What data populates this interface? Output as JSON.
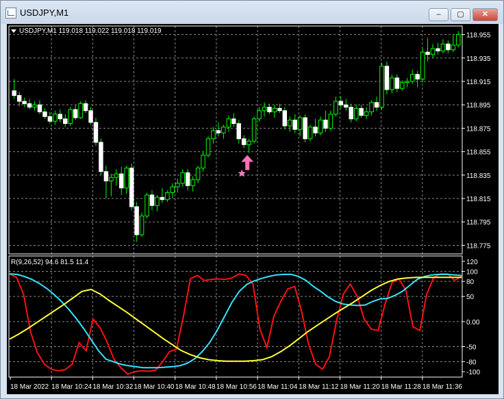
{
  "window": {
    "title": "USDJPY,M1",
    "minimize_glyph": "–",
    "maximize_glyph": "▢",
    "close_glyph": "✕"
  },
  "main_panel": {
    "info": "USDJPY,M1  119.018 119.022 119.018 119.019",
    "price_ticks": [
      "118.955",
      "118.935",
      "118.915",
      "118.895",
      "118.875",
      "118.855",
      "118.835",
      "118.815",
      "118.795",
      "118.775"
    ],
    "price_min": 118.77,
    "price_max": 118.96,
    "candle_color": "#00ff00",
    "candles": [
      [
        118.907,
        118.917,
        118.9,
        118.903
      ],
      [
        118.903,
        118.906,
        118.894,
        118.898
      ],
      [
        118.898,
        118.901,
        118.893,
        118.896
      ],
      [
        118.896,
        118.9,
        118.891,
        118.893
      ],
      [
        118.893,
        118.898,
        118.89,
        118.895
      ],
      [
        118.895,
        118.899,
        118.887,
        118.889
      ],
      [
        118.889,
        118.892,
        118.883,
        118.885
      ],
      [
        118.885,
        118.889,
        118.879,
        118.881
      ],
      [
        118.881,
        118.89,
        118.878,
        118.887
      ],
      [
        118.887,
        118.891,
        118.88,
        118.883
      ],
      [
        118.883,
        118.887,
        118.876,
        118.879
      ],
      [
        118.879,
        118.893,
        118.877,
        118.891
      ],
      [
        118.891,
        118.895,
        118.882,
        118.884
      ],
      [
        118.884,
        118.898,
        118.883,
        118.896
      ],
      [
        118.896,
        118.899,
        118.888,
        118.89
      ],
      [
        118.89,
        118.893,
        118.878,
        118.88
      ],
      [
        118.88,
        118.884,
        118.86,
        118.863
      ],
      [
        118.863,
        118.866,
        118.835,
        118.838
      ],
      [
        118.838,
        118.843,
        118.815,
        118.83
      ],
      [
        118.83,
        118.836,
        118.817,
        118.833
      ],
      [
        118.833,
        118.84,
        118.826,
        118.836
      ],
      [
        118.836,
        118.842,
        118.818,
        118.824
      ],
      [
        118.824,
        118.843,
        118.819,
        118.841
      ],
      [
        118.841,
        118.845,
        118.805,
        118.808
      ],
      [
        118.808,
        118.812,
        118.778,
        118.784
      ],
      [
        118.784,
        118.803,
        118.782,
        118.8
      ],
      [
        118.8,
        118.82,
        118.798,
        118.818
      ],
      [
        118.818,
        118.822,
        118.805,
        118.809
      ],
      [
        118.809,
        118.818,
        118.804,
        118.816
      ],
      [
        118.816,
        118.824,
        118.811,
        118.814
      ],
      [
        118.814,
        118.822,
        118.812,
        118.82
      ],
      [
        118.82,
        118.828,
        118.815,
        118.825
      ],
      [
        118.825,
        118.832,
        118.82,
        118.828
      ],
      [
        118.828,
        118.84,
        118.825,
        118.837
      ],
      [
        118.837,
        118.84,
        118.822,
        118.826
      ],
      [
        118.826,
        118.834,
        118.821,
        118.831
      ],
      [
        118.831,
        118.843,
        118.828,
        118.841
      ],
      [
        118.841,
        118.855,
        118.838,
        118.852
      ],
      [
        118.852,
        118.868,
        118.85,
        118.866
      ],
      [
        118.866,
        118.876,
        118.862,
        118.873
      ],
      [
        118.873,
        118.88,
        118.868,
        118.871
      ],
      [
        118.871,
        118.878,
        118.866,
        118.876
      ],
      [
        118.876,
        118.886,
        118.872,
        118.883
      ],
      [
        118.883,
        118.888,
        118.876,
        118.879
      ],
      [
        118.879,
        118.882,
        118.862,
        118.866
      ],
      [
        118.866,
        118.869,
        118.858,
        118.861
      ],
      [
        118.861,
        118.866,
        118.854,
        118.864
      ],
      [
        118.864,
        118.885,
        118.862,
        118.883
      ],
      [
        118.883,
        118.893,
        118.881,
        118.89
      ],
      [
        118.89,
        118.897,
        118.885,
        118.893
      ],
      [
        118.893,
        118.896,
        118.887,
        118.889
      ],
      [
        118.889,
        118.895,
        118.884,
        118.892
      ],
      [
        118.892,
        118.896,
        118.888,
        118.89
      ],
      [
        118.89,
        118.893,
        118.874,
        118.877
      ],
      [
        118.877,
        118.885,
        118.872,
        118.882
      ],
      [
        118.882,
        118.887,
        118.871,
        118.874
      ],
      [
        118.874,
        118.886,
        118.868,
        118.884
      ],
      [
        118.884,
        118.887,
        118.863,
        118.866
      ],
      [
        118.866,
        118.878,
        118.864,
        118.876
      ],
      [
        118.876,
        118.883,
        118.868,
        118.871
      ],
      [
        118.871,
        118.885,
        118.869,
        118.882
      ],
      [
        118.882,
        118.89,
        118.872,
        118.875
      ],
      [
        118.875,
        118.89,
        118.873,
        118.887
      ],
      [
        118.887,
        118.902,
        118.885,
        118.898
      ],
      [
        118.898,
        118.902,
        118.892,
        118.895
      ],
      [
        118.895,
        118.9,
        118.89,
        118.893
      ],
      [
        118.893,
        118.896,
        118.88,
        118.883
      ],
      [
        118.883,
        118.895,
        118.881,
        118.892
      ],
      [
        118.892,
        118.895,
        118.884,
        118.886
      ],
      [
        118.886,
        118.893,
        118.883,
        118.889
      ],
      [
        118.889,
        118.899,
        118.886,
        118.897
      ],
      [
        118.897,
        118.902,
        118.89,
        118.893
      ],
      [
        118.893,
        118.931,
        118.891,
        118.928
      ],
      [
        118.928,
        118.932,
        118.904,
        118.908
      ],
      [
        118.908,
        118.921,
        118.905,
        118.918
      ],
      [
        118.918,
        118.921,
        118.906,
        118.909
      ],
      [
        118.909,
        118.916,
        118.907,
        118.914
      ],
      [
        118.914,
        118.918,
        118.91,
        118.915
      ],
      [
        118.915,
        118.925,
        118.913,
        118.921
      ],
      [
        118.921,
        118.924,
        118.91,
        118.917
      ],
      [
        118.917,
        118.943,
        118.914,
        118.94
      ],
      [
        118.94,
        118.952,
        118.932,
        118.938
      ],
      [
        118.938,
        118.947,
        118.935,
        118.943
      ],
      [
        118.943,
        118.948,
        118.938,
        118.941
      ],
      [
        118.941,
        118.951,
        118.939,
        118.947
      ],
      [
        118.947,
        118.95,
        118.939,
        118.942
      ],
      [
        118.942,
        118.955,
        118.94,
        118.946
      ],
      [
        118.946,
        118.958,
        118.944,
        118.955
      ]
    ],
    "signal": {
      "index": 45,
      "arrow_color": "#ff6fb4",
      "star_color": "#ff7fc0"
    }
  },
  "indicator_panel": {
    "info": "R(9,26,52) 94.6 81.5 11.4",
    "ticks": [
      "120",
      "100",
      "80",
      "50",
      "0.00",
      "-50",
      "-80",
      "-100"
    ],
    "tick_values": [
      120,
      100,
      80,
      50,
      0,
      -50,
      -80,
      -100
    ],
    "min": -108,
    "max": 128,
    "series": [
      {
        "color": "#ff1010",
        "values": [
          95,
          88,
          55,
          -20,
          -62,
          -85,
          -95,
          -98,
          -96,
          -85,
          -42,
          -58,
          5,
          -12,
          -40,
          -75,
          -92,
          -105,
          -100,
          -98,
          -99,
          -97,
          -80,
          -60,
          -55,
          10,
          85,
          92,
          82,
          84,
          85,
          84,
          87,
          95,
          92,
          75,
          -15,
          -52,
          10,
          40,
          65,
          70,
          20,
          -45,
          -85,
          -95,
          -70,
          0,
          55,
          75,
          50,
          5,
          -15,
          -18,
          35,
          78,
          85,
          62,
          -10,
          -18,
          55,
          88,
          95,
          95,
          82,
          90
        ]
      },
      {
        "color": "#33e5ff",
        "values": [
          95,
          94,
          90,
          84,
          76,
          66,
          54,
          40,
          24,
          6,
          -14,
          -36,
          -58,
          -75,
          -80,
          -85,
          -88,
          -90,
          -92,
          -92,
          -92,
          -91,
          -90,
          -88,
          -83,
          -74,
          -60,
          -42,
          -18,
          10,
          38,
          60,
          74,
          81,
          86,
          90,
          93,
          94,
          94,
          90,
          82,
          70,
          60,
          49,
          40,
          35,
          33,
          32,
          33,
          40,
          45,
          46,
          52,
          60,
          72,
          84,
          90,
          93,
          94,
          94,
          93,
          92
        ]
      },
      {
        "color": "#ffff33",
        "values": [
          -35,
          -25,
          -14,
          -2,
          10,
          22,
          34,
          47,
          60,
          64,
          55,
          42,
          30,
          18,
          5,
          -8,
          -21,
          -34,
          -46,
          -58,
          -66,
          -72,
          -76,
          -78,
          -79,
          -79,
          -79,
          -78,
          -76,
          -70,
          -60,
          -48,
          -34,
          -20,
          -8,
          4,
          16,
          27,
          38,
          50,
          62,
          72,
          80,
          85,
          87,
          88,
          88,
          88,
          88,
          88,
          88
        ]
      }
    ]
  },
  "time_axis": {
    "labels": [
      "18 Mar 2022",
      "18 Mar 10:24",
      "18 Mar 10:32",
      "18 Mar 10:40",
      "18 Mar 10:48",
      "18 Mar 10:56",
      "18 Mar 11:04",
      "18 Mar 11:12",
      "18 Mar 11:20",
      "18 Mar 11:28",
      "18 Mar 11:36"
    ]
  }
}
